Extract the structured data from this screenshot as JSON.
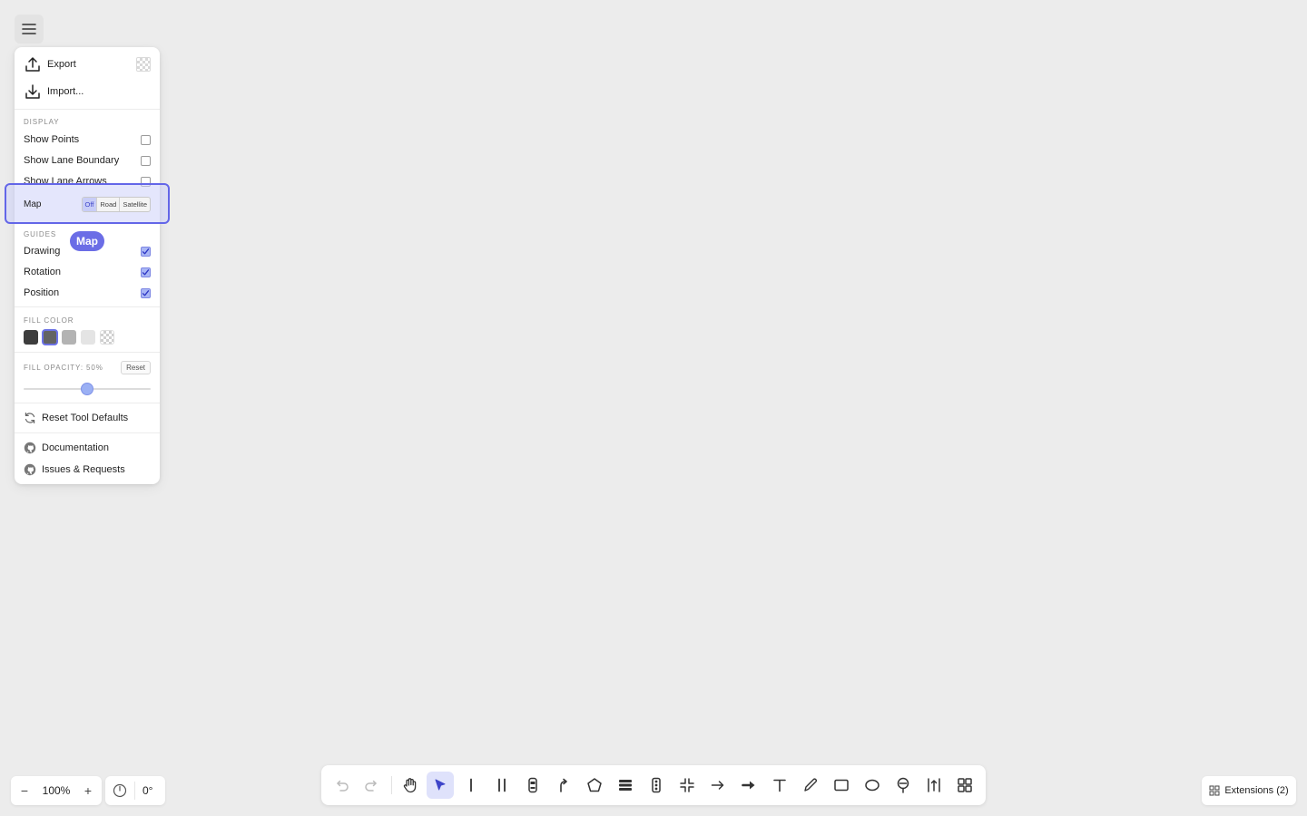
{
  "menu": {
    "export_label": "Export",
    "import_label": "Import...",
    "display": {
      "title": "DISPLAY",
      "items": [
        {
          "label": "Show Points",
          "checked": false
        },
        {
          "label": "Show Lane Boundary",
          "checked": false
        },
        {
          "label": "Show Lane Arrows",
          "checked": false
        }
      ]
    },
    "map": {
      "label": "Map",
      "options": [
        "Off",
        "Road",
        "Satellite"
      ],
      "selected": "Off",
      "badge": "Map"
    },
    "guides": {
      "title": "GUIDES",
      "items": [
        {
          "label": "Drawing",
          "checked": true
        },
        {
          "label": "Rotation",
          "checked": true
        },
        {
          "label": "Position",
          "checked": true
        }
      ]
    },
    "fill_color": {
      "title": "FILL COLOR",
      "swatches": [
        "#3d3d3d",
        "#636363",
        "#b3b3b3",
        "#e4e4e4",
        "transparent"
      ],
      "selected_index": 1
    },
    "fill_opacity": {
      "title": "FILL OPACITY: 50%",
      "value": 0.5,
      "reset_label": "Reset"
    },
    "reset_tool_defaults": "Reset Tool Defaults",
    "links": [
      {
        "label": "Documentation",
        "icon": "github-icon"
      },
      {
        "label": "Issues & Requests",
        "icon": "github-icon"
      }
    ]
  },
  "zoom": {
    "value": "100%",
    "minus": "−",
    "plus": "+"
  },
  "rotation": {
    "value": "0°"
  },
  "toolbar": {
    "tools": [
      "undo-icon",
      "redo-icon",
      "hand-icon",
      "select-arrow-icon",
      "single-line-icon",
      "double-line-icon",
      "vehicle-icon",
      "curved-arrow-icon",
      "polygon-icon",
      "lanes-icon",
      "traffic-light-icon",
      "merge-icon",
      "arrow-icon",
      "bold-arrow-icon",
      "text-icon",
      "pencil-icon",
      "rectangle-icon",
      "ellipse-icon",
      "sign-icon",
      "measure-icon",
      "grid-icon"
    ],
    "active_tool": "select-arrow-icon"
  },
  "extensions": {
    "label": "Extensions (2)"
  },
  "colors": {
    "accent": "#6b6de6",
    "background": "#ececec"
  }
}
